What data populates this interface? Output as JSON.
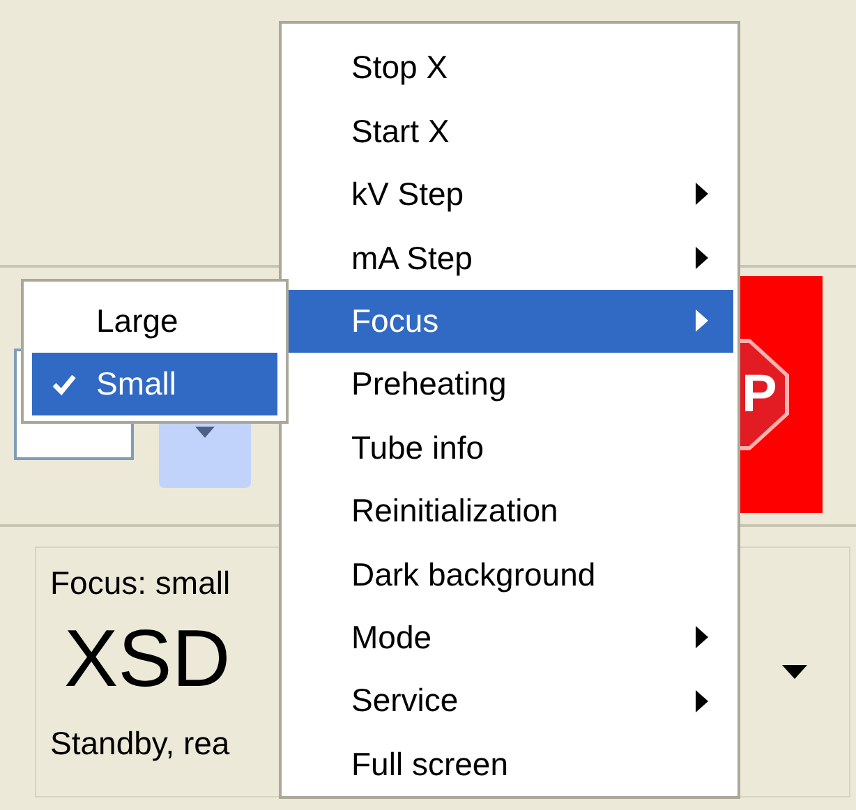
{
  "controls": {
    "stop_button": {
      "label": "P"
    }
  },
  "status_card": {
    "focus": "Focus: small",
    "name": "XSD",
    "status": "Standby, rea"
  },
  "context_menu": {
    "items": [
      {
        "label": "Stop X",
        "kind": "action",
        "selected": false
      },
      {
        "label": "Start X",
        "kind": "action",
        "selected": false
      },
      {
        "label": "kV Step",
        "kind": "submenu",
        "selected": false
      },
      {
        "label": "mA Step",
        "kind": "submenu",
        "selected": false
      },
      {
        "label": "Focus",
        "kind": "submenu",
        "selected": true
      },
      {
        "label": "Preheating",
        "kind": "action",
        "selected": false
      },
      {
        "label": "Tube info",
        "kind": "action",
        "selected": false
      },
      {
        "label": "Reinitialization",
        "kind": "action",
        "selected": false
      },
      {
        "label": "Dark background",
        "kind": "action",
        "selected": false
      },
      {
        "label": "Mode",
        "kind": "submenu",
        "selected": false
      },
      {
        "label": "Service",
        "kind": "submenu",
        "selected": false
      },
      {
        "label": "Full screen",
        "kind": "action",
        "selected": false
      }
    ]
  },
  "focus_submenu": {
    "items": [
      {
        "label": "Large",
        "checked": false,
        "selected": false
      },
      {
        "label": "Small",
        "checked": true,
        "selected": true
      }
    ]
  }
}
